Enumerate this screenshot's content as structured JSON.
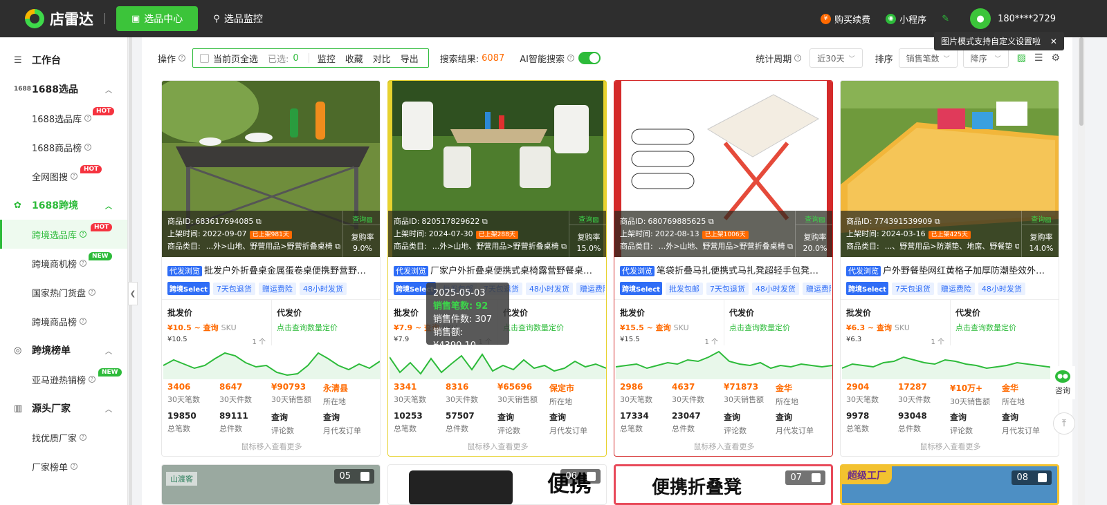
{
  "header": {
    "brand": "店雷达",
    "nav": [
      {
        "label": "选品中心",
        "icon": "bag-icon"
      },
      {
        "label": "选品监控",
        "icon": "location-icon"
      }
    ],
    "buy": "购买续费",
    "mini": "小程序",
    "phone": "180****2729"
  },
  "sidebar": {
    "workbench": "工作台",
    "g1": "1688选品",
    "g1_items": [
      "1688选品库",
      "1688商品榜",
      "全网图搜"
    ],
    "g2": "1688跨境",
    "g2_items": [
      "跨境选品库",
      "跨境商机榜",
      "国家热门货盘",
      "跨境商品榜"
    ],
    "g3": "跨境榜单",
    "g3_items": [
      "亚马逊热销榜"
    ],
    "g4": "源头厂家",
    "g4_items": [
      "找优质厂家",
      "厂家榜单"
    ],
    "hot": "HOT",
    "new": "NEW"
  },
  "toolbar": {
    "op": "操作",
    "select_all": "当前页全选",
    "selected": "已选:",
    "selected_count": "0",
    "monitor": "监控",
    "fav": "收藏",
    "compare": "对比",
    "export": "导出",
    "result_label": "搜索结果:",
    "result_count": "6087",
    "ai": "AI智能搜索",
    "period_label": "统计周期",
    "period": "近30天",
    "sort_label": "排序",
    "sort_by": "销售笔数",
    "order": "降序",
    "tip": "图片模式支持自定义设置啦"
  },
  "labels": {
    "id": "商品ID:",
    "date": "上架时间:",
    "cat": "商品类目:",
    "query_img": "查询",
    "repurchase": "复购率",
    "dist": "代发浏览",
    "wholesale": "批发价",
    "dropship": "代发价",
    "click_query": "点击查询数量定价",
    "sku": "SKU",
    "qty": "1 个",
    "k1": "30天笔数",
    "k2": "30天件数",
    "k3": "30天销售额",
    "k4": "所在地",
    "k5": "总笔数",
    "k6": "总件数",
    "k7": "评论数",
    "k8": "月代发订单",
    "query": "查询",
    "more": "鼠标移入查看更多"
  },
  "products": [
    {
      "id": "683617694085",
      "date": "2022-09-07",
      "days": "已上架981天",
      "cat": "...外>山地、野营用品>野营折叠桌椅",
      "rate": "9.0%",
      "title": "批发户外折叠桌金属蛋卷桌便携野营野餐桌椅套装",
      "tags": [
        "跨境Select",
        "7天包退货",
        "赠运费险",
        "48小时发货"
      ],
      "price": "¥10.5 ~ 查询",
      "base": "¥10.5",
      "s30n": "3406",
      "s30q": "8647",
      "s30a": "¥90793",
      "loc": "永清县",
      "tn": "19850",
      "tq": "89111"
    },
    {
      "id": "820517829622",
      "date": "2024-07-30",
      "days": "已上架288天",
      "cat": "...外>山地、野营用品>野营折叠桌椅",
      "rate": "15.0%",
      "title": "厂家户外折叠桌便携式桌椅露营野餐桌子烧烤桌",
      "tags": [
        "跨境Select",
        "批发包邮",
        "7天包退货",
        "48小时发货",
        "赠运费险"
      ],
      "price": "¥7.9 ~ 查询",
      "base": "¥7.9",
      "s30n": "3341",
      "s30q": "8316",
      "s30a": "¥65696",
      "loc": "保定市",
      "tn": "10253",
      "tq": "57507"
    },
    {
      "id": "680769885625",
      "date": "2022-08-13",
      "days": "已上架1006天",
      "cat": "...外>山地、野营用品>野营折叠桌椅",
      "rate": "20.0%",
      "title": "笔袋折叠马扎便携式马扎凳超轻手包凳子户外钓鱼",
      "tags": [
        "跨境Select",
        "批发包邮",
        "7天包退货",
        "48小时发货",
        "赠运费险"
      ],
      "price": "¥15.5 ~ 查询",
      "base": "¥15.5",
      "s30n": "2986",
      "s30q": "4637",
      "s30a": "¥71873",
      "loc": "金华",
      "tn": "17334",
      "tq": "23047"
    },
    {
      "id": "774391539909",
      "date": "2024-03-16",
      "days": "已上架425天",
      "cat": "...、野营用品>防潮垫、地席、野餐垫",
      "rate": "14.0%",
      "title": "户外野餐垫网红黄格子加厚防潮垫效外可折叠",
      "tags": [
        "跨境Select",
        "7天包退货",
        "赠运费险",
        "48小时发货"
      ],
      "price": "¥6.3 ~ 查询",
      "base": "¥6.3",
      "s30n": "2904",
      "s30q": "17287",
      "s30a": "¥10万+",
      "loc": "金华",
      "tn": "9978",
      "tq": "93048"
    }
  ],
  "tooltip": {
    "date": "2025-05-03",
    "l1": "销售笔数:",
    "v1": "92",
    "l2": "销售件数:",
    "v2": "307",
    "l3": "销售额:",
    "v3": "¥4390.10"
  },
  "row2": [
    {
      "num": "05",
      "text": "山渡客"
    },
    {
      "num": "06",
      "text": "便携"
    },
    {
      "num": "07",
      "text": "便携折叠凳"
    },
    {
      "num": "08",
      "text": "超级工厂"
    }
  ],
  "float": {
    "consult": "咨询"
  },
  "colors": {
    "green": "#2dbb3a",
    "orange": "#ff6a00",
    "blue": "#2f6df6",
    "dark": "#2e2e2e"
  }
}
